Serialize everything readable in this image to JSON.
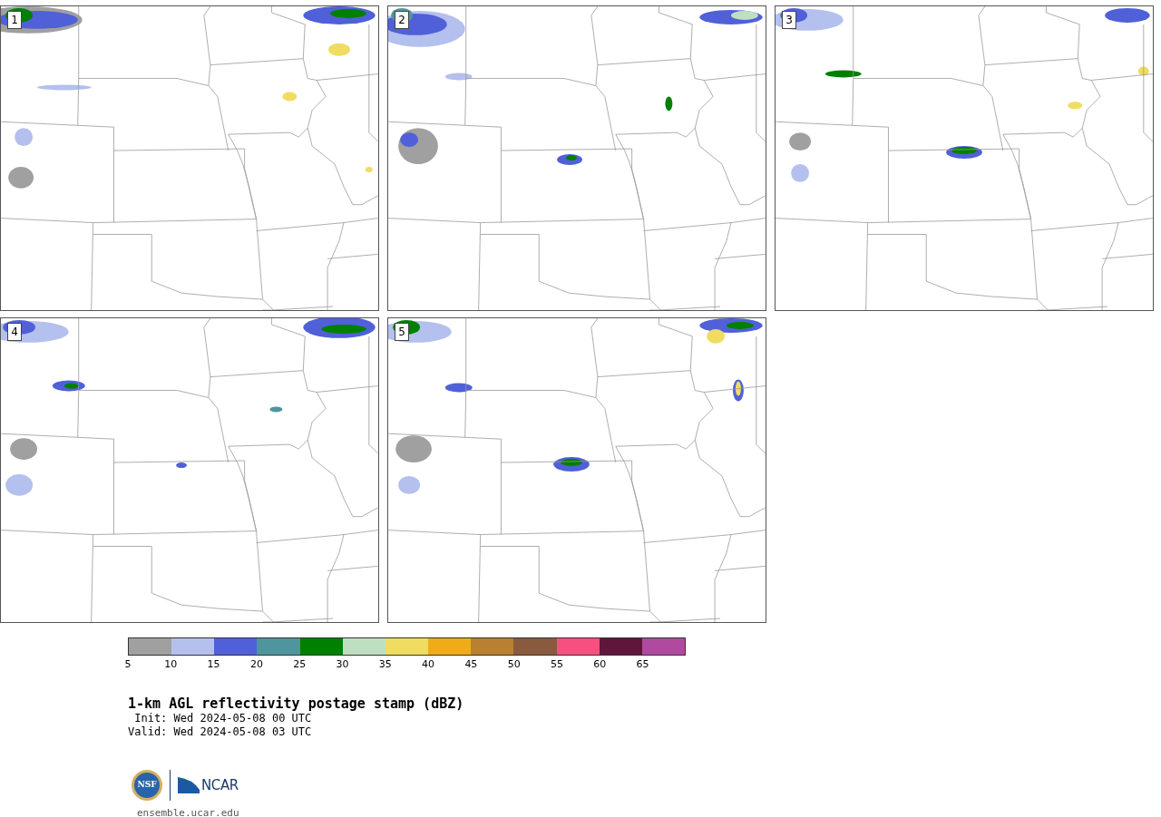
{
  "panels": [
    {
      "number": "1"
    },
    {
      "number": "2"
    },
    {
      "number": "3"
    },
    {
      "number": "4"
    },
    {
      "number": "5"
    }
  ],
  "colorbar": {
    "segments": [
      {
        "color": "#a0a0a0"
      },
      {
        "color": "#b4c0ee"
      },
      {
        "color": "#5060d8"
      },
      {
        "color": "#4e969e"
      },
      {
        "color": "#008000"
      },
      {
        "color": "#bfe0c0"
      },
      {
        "color": "#f0dc60"
      },
      {
        "color": "#f0ac18"
      },
      {
        "color": "#b88030"
      },
      {
        "color": "#8a5a3e"
      },
      {
        "color": "#f5507e"
      },
      {
        "color": "#60163a"
      },
      {
        "color": "#b04aa0"
      }
    ],
    "ticks": [
      "5",
      "10",
      "15",
      "20",
      "25",
      "30",
      "35",
      "40",
      "45",
      "50",
      "55",
      "60",
      "65"
    ]
  },
  "title": "1-km AGL reflectivity postage stamp (dBZ)",
  "init": " Init: Wed 2024-05-08 00 UTC",
  "valid": "Valid: Wed 2024-05-08 03 UTC",
  "logos": {
    "nsf": "NSF",
    "ncar": "NCAR"
  },
  "url": "ensemble.ucar.edu"
}
